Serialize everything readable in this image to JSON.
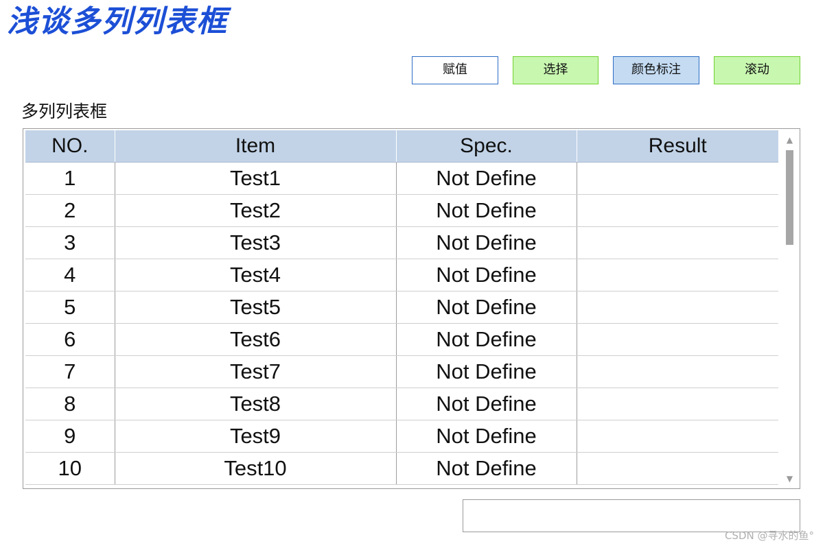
{
  "window": {
    "title": "浅谈多列列表框"
  },
  "toolbar": {
    "assign_label": "赋值",
    "select_label": "选择",
    "color_label": "颜色标注",
    "scroll_label": "滚动"
  },
  "listview": {
    "group_label": "多列列表框",
    "columns": [
      "NO.",
      "Item",
      "Spec.",
      "Result"
    ],
    "rows": [
      {
        "no": "1",
        "item": "Test1",
        "spec": "Not Define",
        "result": ""
      },
      {
        "no": "2",
        "item": "Test2",
        "spec": "Not Define",
        "result": ""
      },
      {
        "no": "3",
        "item": "Test3",
        "spec": "Not Define",
        "result": ""
      },
      {
        "no": "4",
        "item": "Test4",
        "spec": "Not Define",
        "result": ""
      },
      {
        "no": "5",
        "item": "Test5",
        "spec": "Not Define",
        "result": ""
      },
      {
        "no": "6",
        "item": "Test6",
        "spec": "Not Define",
        "result": ""
      },
      {
        "no": "7",
        "item": "Test7",
        "spec": "Not Define",
        "result": ""
      },
      {
        "no": "8",
        "item": "Test8",
        "spec": "Not Define",
        "result": ""
      },
      {
        "no": "9",
        "item": "Test9",
        "spec": "Not Define",
        "result": ""
      },
      {
        "no": "10",
        "item": "Test10",
        "spec": "Not Define",
        "result": ""
      }
    ],
    "scroll_up_icon": "triangle-up-icon",
    "scroll_down_icon": "triangle-down-icon"
  },
  "status": {
    "value": ""
  },
  "watermark": {
    "text": "CSDN @寻水的鱼°"
  },
  "colors": {
    "title_blue": "#1c4fd6",
    "header_bg": "#c2d3e7",
    "button_green_bg": "#c8f7b0",
    "button_green_border": "#6fd12e",
    "button_blue_bg": "#c4dbf2",
    "button_blue_border": "#2b6cc4"
  }
}
